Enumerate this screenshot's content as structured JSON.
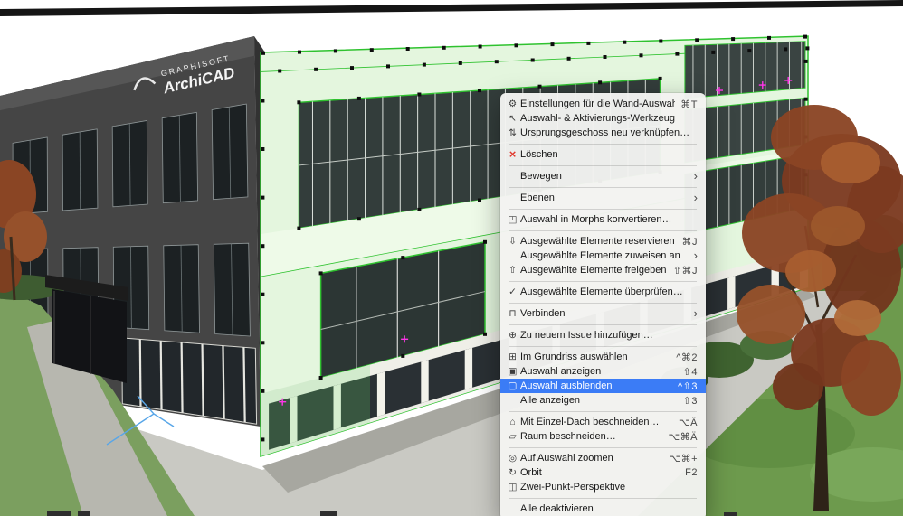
{
  "colors": {
    "menu_highlight": "#3b7cf6",
    "delete_red": "#e0392d",
    "selection_green": "#2fc22f",
    "selection_fill": "#e4f6de",
    "marker_magenta": "#ff35e8"
  },
  "scene": {
    "logo_top": "GRAPHISOFT",
    "logo_bottom": "ArchiCAD"
  },
  "menu": {
    "submenu_glyph": "›",
    "items": [
      {
        "label": "Einstellungen für die Wand-Auswahl",
        "shortcut": "⌘T",
        "icon": "⚙"
      },
      {
        "label": "Auswahl- & Aktivierungs-Werkzeug",
        "shortcut": "",
        "icon": "↖"
      },
      {
        "label": "Ursprungsgeschoss neu verknüpfen…",
        "shortcut": "",
        "icon": "⇅"
      },
      {
        "label": "Löschen",
        "shortcut": "",
        "icon": "×"
      },
      {
        "label": "Bewegen",
        "shortcut": "",
        "icon": ""
      },
      {
        "label": "Ebenen",
        "shortcut": "",
        "icon": ""
      },
      {
        "label": "Auswahl in Morphs konvertieren…",
        "shortcut": "",
        "icon": "◳"
      },
      {
        "label": "Ausgewählte Elemente reservieren",
        "shortcut": "⌘J",
        "icon": "⇩"
      },
      {
        "label": "Ausgewählte Elemente zuweisen an",
        "shortcut": "",
        "icon": ""
      },
      {
        "label": "Ausgewählte Elemente freigeben",
        "shortcut": "⇧⌘J",
        "icon": "⇧"
      },
      {
        "label": "Ausgewählte Elemente überprüfen…",
        "shortcut": "",
        "icon": "✓"
      },
      {
        "label": "Verbinden",
        "shortcut": "",
        "icon": "⊓"
      },
      {
        "label": "Zu neuem Issue hinzufügen…",
        "shortcut": "",
        "icon": "⊕"
      },
      {
        "label": "Im Grundriss auswählen",
        "shortcut": "^⌘2",
        "icon": "⊞"
      },
      {
        "label": "Auswahl anzeigen",
        "shortcut": "⇧4",
        "icon": "▣"
      },
      {
        "label": "Auswahl ausblenden",
        "shortcut": "^⇧3",
        "icon": "▢"
      },
      {
        "label": "Alle anzeigen",
        "shortcut": "⇧3",
        "icon": ""
      },
      {
        "label": "Mit Einzel-Dach beschneiden…",
        "shortcut": "⌥Ä",
        "icon": "⌂"
      },
      {
        "label": "Raum beschneiden…",
        "shortcut": "⌥⌘Ä",
        "icon": "▱"
      },
      {
        "label": "Auf Auswahl zoomen",
        "shortcut": "⌥⌘+",
        "icon": "◎"
      },
      {
        "label": "Orbit",
        "shortcut": "F2",
        "icon": "↻"
      },
      {
        "label": "Zwei-Punkt-Perspektive",
        "shortcut": "",
        "icon": "◫"
      },
      {
        "label": "Alle deaktivieren",
        "shortcut": "",
        "icon": ""
      }
    ]
  }
}
